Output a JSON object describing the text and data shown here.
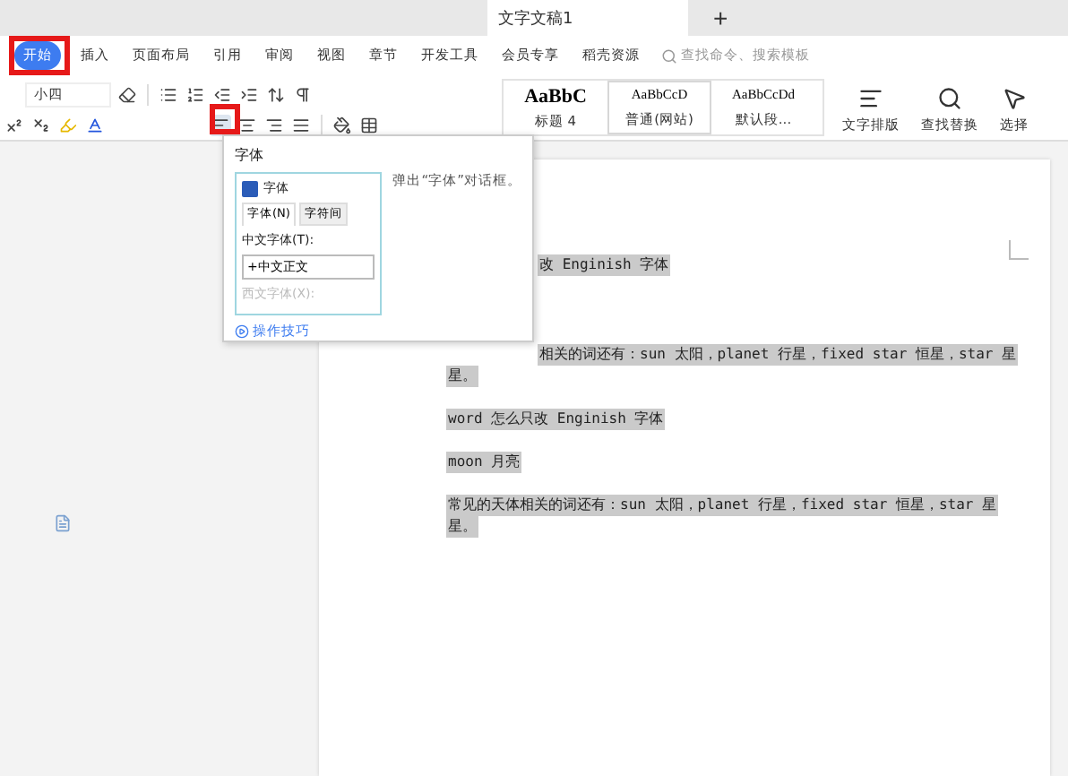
{
  "title_bar": {
    "document_tab": "文字文稿1",
    "new_tab": "+"
  },
  "menu": {
    "items": [
      {
        "label": "开始",
        "selected": true
      },
      {
        "label": "插入",
        "selected": false
      },
      {
        "label": "页面布局",
        "selected": false
      },
      {
        "label": "引用",
        "selected": false
      },
      {
        "label": "审阅",
        "selected": false
      },
      {
        "label": "视图",
        "selected": false
      },
      {
        "label": "章节",
        "selected": false
      },
      {
        "label": "开发工具",
        "selected": false
      },
      {
        "label": "会员专享",
        "selected": false
      },
      {
        "label": "稻壳资源",
        "selected": false
      }
    ],
    "search": {
      "placeholder": "查找命令、搜索模板"
    }
  },
  "toolbar": {
    "font_size": "小四",
    "styles": [
      {
        "preview": "AaBbC",
        "name": "标题 4",
        "selected": false
      },
      {
        "preview": "AaBbCcD",
        "name": "普通(网站)",
        "selected": true
      },
      {
        "preview": "AaBbCcDd",
        "name": "默认段..."
      }
    ],
    "tools": [
      {
        "kind": "layout",
        "label": "文字排版"
      },
      {
        "kind": "find",
        "label": "查找替换"
      },
      {
        "kind": "select",
        "label": "选择"
      }
    ]
  },
  "tooltip": {
    "title": "字体",
    "dialog_preview": {
      "title": "字体",
      "tabs": [
        {
          "label": "字体(N)",
          "selected": true
        },
        {
          "label": "字符间",
          "selected": false
        }
      ],
      "field_label": "中文字体(T):",
      "field_value": "+中文正文",
      "faded_label": "西文字体(X):"
    },
    "description": "弹出“字体”对话框。",
    "link": "操作技巧"
  },
  "document": {
    "paragraphs": [
      {
        "kind": "partial",
        "lines": [
          "改 Enginish 字体"
        ]
      },
      {
        "kind": "partial",
        "lines": [
          "相关的词还有：sun 太阳，planet 行星，fixed star 恒星，star 星",
          "星。"
        ]
      },
      {
        "kind": "full",
        "lines": [
          "word 怎么只改 Enginish 字体"
        ]
      },
      {
        "kind": "full",
        "lines": [
          "moon 月亮"
        ]
      },
      {
        "kind": "full",
        "lines": [
          "常见的天体相关的词还有：sun 太阳，planet 行星，fixed star 恒星，star 星",
          "星。"
        ]
      }
    ]
  }
}
